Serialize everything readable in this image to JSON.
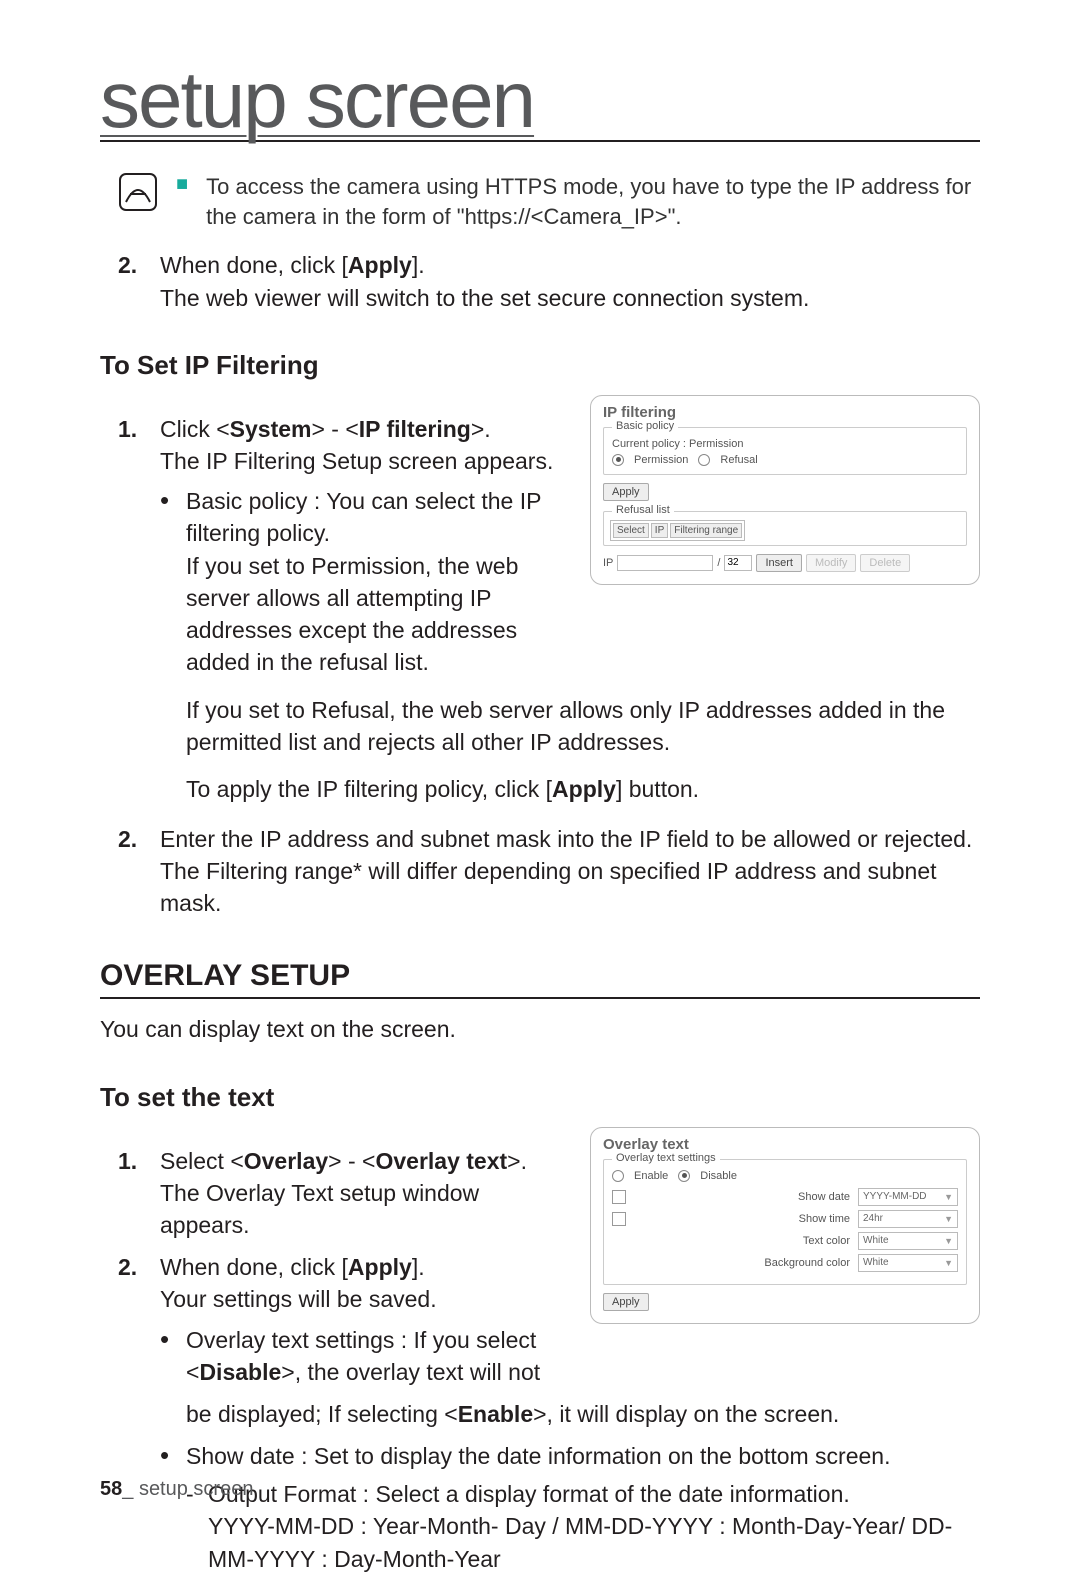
{
  "page_title": "setup screen",
  "note": {
    "text": "To access the camera using HTTPS mode, you have to type the IP address for the camera in the form of \"https://<Camera_IP>\"."
  },
  "https_steps": {
    "step2_prefix": "When done, click [",
    "step2_apply": "Apply",
    "step2_suffix": "].",
    "step2_line2": "The web viewer will switch to the set secure connection system."
  },
  "ip_filtering": {
    "heading": "To Set IP Filtering",
    "step1_prefix": "Click <",
    "step1_system": "System",
    "step1_mid": "> - <",
    "step1_ipf": "IP filtering",
    "step1_suffix": ">.",
    "step1_line2": "The IP Filtering Setup screen appears.",
    "bullet_basic": "Basic policy : You can select the IP filtering policy.",
    "bullet_basic_lines": "If you set to Permission, the web server allows all attempting IP addresses except the addresses added in the refusal list.",
    "refusal_lines": "If you set to Refusal, the web server allows only IP addresses added in the permitted list and rejects all other IP addresses.",
    "apply_line_prefix": "To apply the IP filtering policy, click [",
    "apply_bold": "Apply",
    "apply_line_suffix": "] button.",
    "step2": "Enter the IP address and subnet mask into the IP field to be allowed or rejected. The Filtering range* will differ depending on specified IP address and subnet mask."
  },
  "ip_panel": {
    "title": "IP filtering",
    "basic_legend": "Basic policy",
    "current": "Current policy : Permission",
    "permission": "Permission",
    "refusal": "Refusal",
    "apply": "Apply",
    "refusal_legend": "Refusal list",
    "th_select": "Select",
    "th_ip": "IP",
    "th_range": "Filtering range",
    "ip_label": "IP",
    "cidr": "32",
    "insert": "Insert",
    "modify": "Modify",
    "delete": "Delete"
  },
  "overlay_section": {
    "heading": "OVERLAY SETUP",
    "intro": "You can display text on the screen.",
    "sub_heading": "To set the text",
    "step1_prefix": "Select <",
    "step1_overlay": "Overlay",
    "step1_mid": "> - <",
    "step1_text": "Overlay text",
    "step1_suffix": ">.",
    "step1_line2": "The Overlay Text setup window appears.",
    "step2_prefix": "When done, click [",
    "step2_apply": "Apply",
    "step2_suffix": "].",
    "step2_line2": "Your settings will be saved.",
    "bullet_settings_prefix": "Overlay text settings : If you select <",
    "bullet_disable": "Disable",
    "bullet_settings_mid": ">, the overlay text will not be displayed; If selecting <",
    "bullet_enable": "Enable",
    "bullet_settings_suffix": ">, it will display on the screen.",
    "bullet_showdate": "Show date : Set to display the date information on the bottom screen.",
    "dash_output": "Output Format : Select a display format of the date information.",
    "dash_output2": "YYYY-MM-DD : Year-Month- Day / MM-DD-YYYY : Month-Day-Year/ DD-MM-YYYY : Day-Month-Year"
  },
  "overlay_panel": {
    "title": "Overlay text",
    "legend": "Overlay text settings",
    "enable": "Enable",
    "disable": "Disable",
    "show_date": "Show date",
    "show_date_val": "YYYY-MM-DD",
    "show_time": "Show time",
    "show_time_val": "24hr",
    "text_color": "Text color",
    "text_color_val": "White",
    "bg_color": "Background color",
    "bg_color_val": "White",
    "apply": "Apply"
  },
  "footer": {
    "page_num": "58",
    "sep": "_ ",
    "label": "setup screen"
  }
}
